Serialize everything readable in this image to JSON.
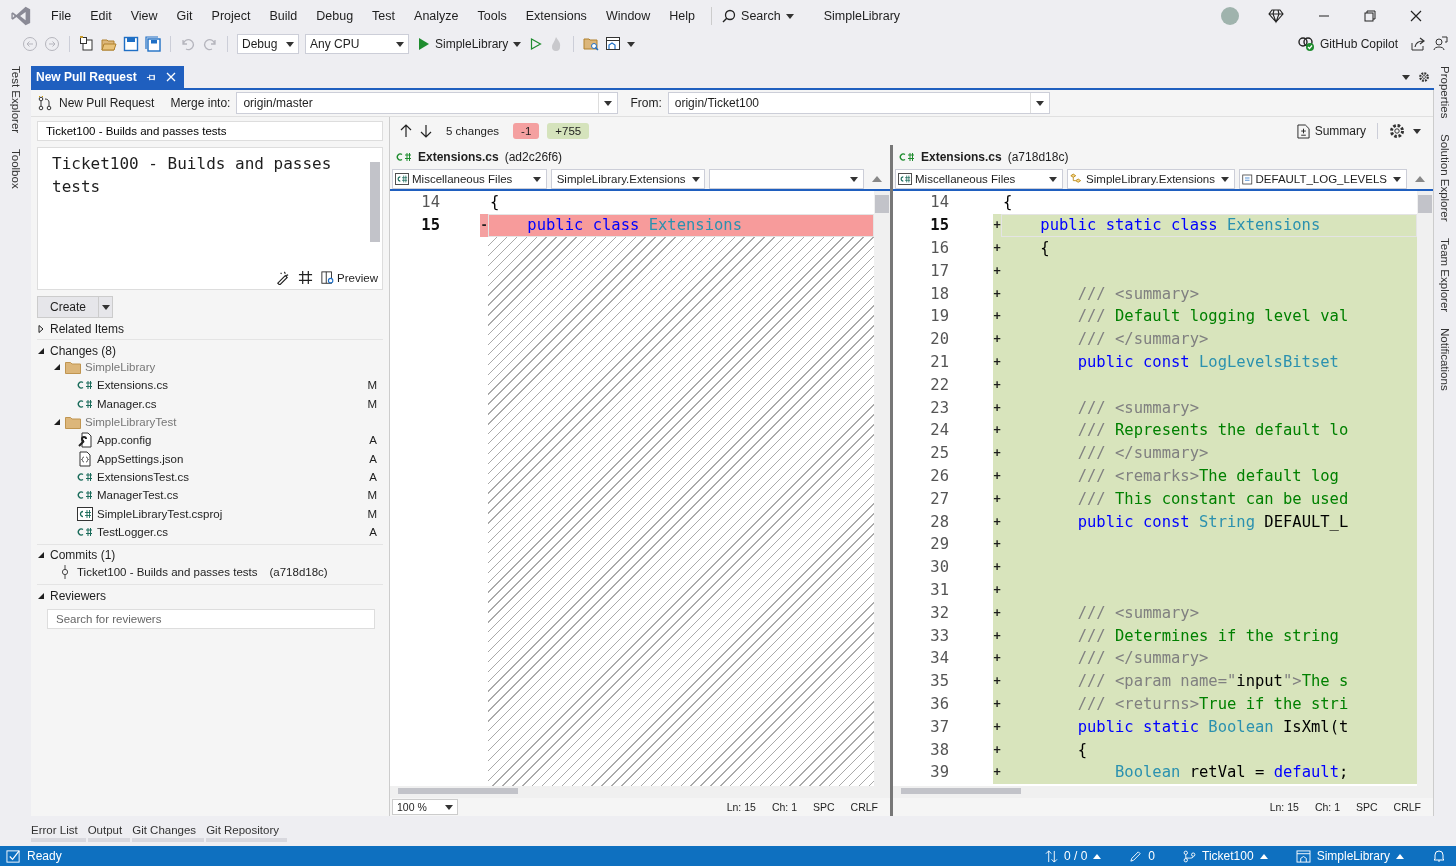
{
  "menu_bar": {
    "items": [
      "File",
      "Edit",
      "View",
      "Git",
      "Project",
      "Build",
      "Debug",
      "Test",
      "Analyze",
      "Tools",
      "Extensions",
      "Window",
      "Help"
    ],
    "search": "Search",
    "solution_name": "SimpleLibrary"
  },
  "toolbar": {
    "configuration": "Debug",
    "platform": "Any CPU",
    "startup_project": "SimpleLibrary",
    "copilot": "GitHub Copilot"
  },
  "left_tool_tabs": [
    "Test Explorer",
    "Toolbox"
  ],
  "right_tool_tabs": [
    "Properties",
    "Solution Explorer",
    "Team Explorer",
    "Notifications"
  ],
  "document_tabs": [
    {
      "title": "New Pull Request",
      "selected": true
    }
  ],
  "pr_header": {
    "title": "New Pull Request",
    "merge_label": "Merge into:",
    "merge_value": "origin/master",
    "from_label": "From:",
    "from_value": "origin/Ticket100"
  },
  "pr_form": {
    "title_value": "Ticket100 - Builds and passes tests",
    "description_value": "Ticket100 - Builds and passes tests",
    "preview": "Preview",
    "create": "Create"
  },
  "related_items": {
    "title": "Related Items",
    "expanded": false
  },
  "changes": {
    "title": "Changes (8)",
    "expanded": true,
    "folders": [
      {
        "name": "SimpleLibrary",
        "expanded": true,
        "files": [
          {
            "name": "Extensions.cs",
            "kind": "cs",
            "status": "M"
          },
          {
            "name": "Manager.cs",
            "kind": "cs",
            "status": "M"
          }
        ]
      },
      {
        "name": "SimpleLibraryTest",
        "expanded": true,
        "files": [
          {
            "name": "App.config",
            "kind": "config",
            "status": "A"
          },
          {
            "name": "AppSettings.json",
            "kind": "json",
            "status": "A"
          },
          {
            "name": "ExtensionsTest.cs",
            "kind": "cs",
            "status": "A"
          },
          {
            "name": "ManagerTest.cs",
            "kind": "cs",
            "status": "M"
          },
          {
            "name": "SimpleLibraryTest.csproj",
            "kind": "csproj",
            "status": "M"
          },
          {
            "name": "TestLogger.cs",
            "kind": "cs",
            "status": "A"
          }
        ]
      }
    ]
  },
  "commits": {
    "title": "Commits (1)",
    "expanded": true,
    "items": [
      {
        "message": "Ticket100 - Builds and passes tests",
        "hash": "(a718d18c)"
      }
    ]
  },
  "reviewers": {
    "title": "Reviewers",
    "expanded": true,
    "placeholder": "Search for reviewers"
  },
  "diff_toolbar": {
    "changes": "5 changes",
    "removed": "-1",
    "added": "+755",
    "summary": "Summary"
  },
  "panes": [
    {
      "file": "Extensions.cs",
      "commit": "(ad2c26f6)",
      "project": "Miscellaneous Files",
      "scope": "SimpleLibrary.Extensions",
      "hatched": true,
      "zoom": "100 %",
      "status": [
        "Ln: 15",
        "Ch: 1",
        "SPC",
        "CRLF"
      ],
      "lines": [
        {
          "number": "14",
          "current": false,
          "kind": "unchanged",
          "segments": [
            {
              "kind": "plain",
              "t": "{"
            }
          ]
        },
        {
          "number": "15",
          "current": true,
          "kind": "removed",
          "marker": "-",
          "segments": [
            {
              "kind": "keyword",
              "t": "    public class "
            },
            {
              "kind": "type",
              "t": "Extensions"
            }
          ]
        }
      ]
    },
    {
      "file": "Extensions.cs",
      "commit": "(a718d18c)",
      "project": "Miscellaneous Files",
      "scope": "SimpleLibrary.Extensions",
      "member": "DEFAULT_LOG_LEVELS",
      "status": [
        "Ln: 15",
        "Ch: 1",
        "SPC",
        "CRLF"
      ],
      "lines": [
        {
          "number": "14",
          "current": false,
          "kind": "unchanged",
          "segments": [
            {
              "kind": "plain",
              "t": "{"
            }
          ]
        },
        {
          "number": "15",
          "current": true,
          "kind": "added",
          "marker": "+",
          "segments": [
            {
              "kind": "keyword",
              "t": "    public static class "
            },
            {
              "kind": "type",
              "t": "Extensions"
            }
          ]
        },
        {
          "number": "16",
          "current": false,
          "kind": "added",
          "marker": "+",
          "segments": [
            {
              "kind": "plain",
              "t": "    {"
            }
          ]
        },
        {
          "number": "17",
          "current": false,
          "kind": "added",
          "marker": "+"
        },
        {
          "number": "18",
          "current": false,
          "kind": "added",
          "marker": "+",
          "segments": [
            {
              "kind": "doctag",
              "t": "        /// <summary>"
            }
          ]
        },
        {
          "number": "19",
          "current": false,
          "kind": "added",
          "marker": "+",
          "segments": [
            {
              "kind": "doctag",
              "t": "        ///"
            },
            {
              "kind": "comment",
              "t": " Default logging level val"
            }
          ]
        },
        {
          "number": "20",
          "current": false,
          "kind": "added",
          "marker": "+",
          "segments": [
            {
              "kind": "doctag",
              "t": "        /// </summary>"
            }
          ]
        },
        {
          "number": "21",
          "current": false,
          "kind": "added",
          "marker": "+",
          "segments": [
            {
              "kind": "keyword",
              "t": "        public const "
            },
            {
              "kind": "type",
              "t": "LogLevelsBitset"
            }
          ]
        },
        {
          "number": "22",
          "current": false,
          "kind": "added",
          "marker": "+"
        },
        {
          "number": "23",
          "current": false,
          "kind": "added",
          "marker": "+",
          "segments": [
            {
              "kind": "doctag",
              "t": "        /// <summary>"
            }
          ]
        },
        {
          "number": "24",
          "current": false,
          "kind": "added",
          "marker": "+",
          "segments": [
            {
              "kind": "doctag",
              "t": "        ///"
            },
            {
              "kind": "comment",
              "t": " Represents the default lo"
            }
          ]
        },
        {
          "number": "25",
          "current": false,
          "kind": "added",
          "marker": "+",
          "segments": [
            {
              "kind": "doctag",
              "t": "        /// </summary>"
            }
          ]
        },
        {
          "number": "26",
          "current": false,
          "kind": "added",
          "marker": "+",
          "segments": [
            {
              "kind": "doctag",
              "t": "        /// <remarks>"
            },
            {
              "kind": "comment",
              "t": "The default log"
            }
          ]
        },
        {
          "number": "27",
          "current": false,
          "kind": "added",
          "marker": "+",
          "segments": [
            {
              "kind": "doctag",
              "t": "        ///"
            },
            {
              "kind": "comment",
              "t": " This constant can be used"
            }
          ]
        },
        {
          "number": "28",
          "current": false,
          "kind": "added",
          "marker": "+",
          "segments": [
            {
              "kind": "keyword",
              "t": "        public const "
            },
            {
              "kind": "type",
              "t": "String"
            },
            {
              "kind": "plain",
              "t": " DEFAULT_L"
            }
          ]
        },
        {
          "number": "29",
          "current": false,
          "kind": "added",
          "marker": "+"
        },
        {
          "number": "30",
          "current": false,
          "kind": "added",
          "marker": "+"
        },
        {
          "number": "31",
          "current": false,
          "kind": "added",
          "marker": "+"
        },
        {
          "number": "32",
          "current": false,
          "kind": "added",
          "marker": "+",
          "segments": [
            {
              "kind": "doctag",
              "t": "        /// <summary>"
            }
          ]
        },
        {
          "number": "33",
          "current": false,
          "kind": "added",
          "marker": "+",
          "segments": [
            {
              "kind": "doctag",
              "t": "        ///"
            },
            {
              "kind": "comment",
              "t": " Determines if the string"
            }
          ]
        },
        {
          "number": "34",
          "current": false,
          "kind": "added",
          "marker": "+",
          "segments": [
            {
              "kind": "doctag",
              "t": "        /// </summary>"
            }
          ]
        },
        {
          "number": "35",
          "current": false,
          "kind": "added",
          "marker": "+",
          "segments": [
            {
              "kind": "doctag",
              "t": "        /// <param name=\""
            },
            {
              "kind": "plain",
              "t": "input"
            },
            {
              "kind": "doctag",
              "t": "\">"
            },
            {
              "kind": "comment",
              "t": "The s"
            }
          ]
        },
        {
          "number": "36",
          "current": false,
          "kind": "added",
          "marker": "+",
          "segments": [
            {
              "kind": "doctag",
              "t": "        /// <returns>"
            },
            {
              "kind": "comment",
              "t": "True if the stri"
            }
          ]
        },
        {
          "number": "37",
          "current": false,
          "kind": "added",
          "marker": "+",
          "segments": [
            {
              "kind": "keyword",
              "t": "        public static "
            },
            {
              "kind": "type",
              "t": "Boolean"
            },
            {
              "kind": "plain",
              "t": " IsXml(t"
            }
          ]
        },
        {
          "number": "38",
          "current": false,
          "kind": "added",
          "marker": "+",
          "segments": [
            {
              "kind": "plain",
              "t": "        {"
            }
          ]
        },
        {
          "number": "39",
          "current": false,
          "kind": "added",
          "marker": "+",
          "segments": [
            {
              "kind": "type",
              "t": "            Boolean"
            },
            {
              "kind": "plain",
              "t": " retVal = "
            },
            {
              "kind": "keyword",
              "t": "default"
            },
            {
              "kind": "plain",
              "t": ";"
            }
          ]
        }
      ]
    }
  ],
  "bottom_tabs": [
    "Error List",
    "Output",
    "Git Changes",
    "Git Repository"
  ],
  "status_bar": {
    "ready": "Ready",
    "sync": "0 / 0",
    "edits": "0",
    "branch": "Ticket100",
    "repository": "SimpleLibrary"
  }
}
